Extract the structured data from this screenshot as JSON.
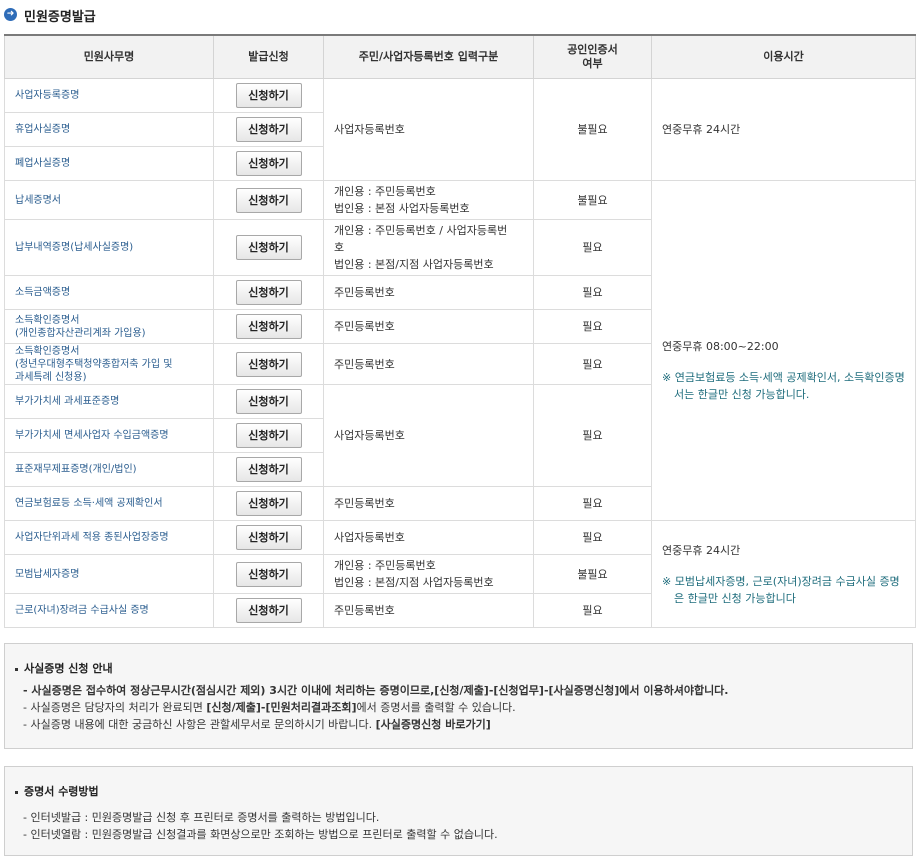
{
  "page_title": "민원증명발급",
  "table": {
    "headers": [
      "민원사무명",
      "발급신청",
      "주민/사업자등록번호 입력구분",
      "공인인증서\n여부",
      "이용시간"
    ],
    "button_label": "신청하기",
    "rows": [
      {
        "name": "사업자등록증명"
      },
      {
        "name": "휴업사실증명"
      },
      {
        "name": "폐업사실증명"
      },
      {
        "name": "납세증명서"
      },
      {
        "name": "납부내역증명(납세사실증명)"
      },
      {
        "name": "소득금액증명"
      },
      {
        "name": "소득확인증명서\n(개인종합자산관리계좌 가입용)"
      },
      {
        "name": "소득확인증명서\n(청년우대형주택청약종합저축 가입 및\n과세특례 신청용)"
      },
      {
        "name": "부가가치세 과세표준증명"
      },
      {
        "name": "부가가치세 면세사업자 수입금액증명"
      },
      {
        "name": "표준재무제표증명(개인/법인)"
      },
      {
        "name": "연금보험료등 소득·세액 공제확인서"
      },
      {
        "name": "사업자단위과세 적용 종된사업장증명"
      },
      {
        "name": "모범납세자증명"
      },
      {
        "name": "근로(자녀)장려금 수급사실 증명"
      }
    ],
    "input_types": {
      "biz_1": "사업자등록번호",
      "tax_cert": "개인용 : 주민등록번호\n법인용 : 본점 사업자등록번호",
      "payment": "개인용 : 주민등록번호 / 사업자등록번\n호\n법인용 : 본점/지점 사업자등록번호",
      "resident_a": "주민등록번호",
      "resident_b": "주민등록번호",
      "resident_c": "주민등록번호",
      "biz_2": "사업자등록번호",
      "resident_d": "주민등록번호",
      "biz_3": "사업자등록번호",
      "model": "개인용 : 주민등록번호\n법인용 : 본점/지점 사업자등록번호",
      "resident_e": "주민등록번호"
    },
    "cert": {
      "c1": "불필요",
      "c2": "불필요",
      "c3": "필요",
      "c4": "필요",
      "c5": "필요",
      "c6": "필요",
      "c7": "필요",
      "c8": "필요",
      "c9": "필요",
      "c10": "불필요",
      "c11": "필요"
    },
    "hours": {
      "h1": "연중무휴 24시간",
      "h2": "연중무휴 08:00~22:00",
      "h2_note": "※ 연금보험료등 소득·세액 공제확인서, 소득확인증명서는 한글만 신청 가능합니다.",
      "h3": "연중무휴 24시간",
      "h3_note": "※ 모범납세자증명, 근로(자녀)장려금 수급사실 증명은 한글만 신청 가능합니다"
    }
  },
  "fact_cert_box": {
    "title": "사실증명 신청 안내",
    "line1": "- 사실증명은 접수하여 정상근무시간(점심시간 제외) 3시간 이내에 처리하는 증명이므로,[신청/제출]-[신청업무]-[사실증명신청]에서 이용하셔야합니다.",
    "line2_pre": "- 사실증명은 담당자의 처리가 완료되면 ",
    "line2_bold": "[신청/제출]-[민원처리결과조회]",
    "line2_post": "에서 증명서를 출력할 수 있습니다.",
    "line3_pre": "- 사실증명 내용에 대한 궁금하신 사항은 관할세무서로 문의하시기 바랍니다. ",
    "line3_link": "[사실증명신청 바로가기]"
  },
  "receive_box": {
    "title": "증명서 수령방법",
    "line1": "- 인터넷발급 : 민원증명발급 신청 후 프린터로 증명서를 출력하는 방법입니다.",
    "line2": "- 인터넷열람 : 민원증명발급 신청결과를 화면상으로만 조회하는 방법으로 프린터로 출력할 수 없습니다."
  }
}
